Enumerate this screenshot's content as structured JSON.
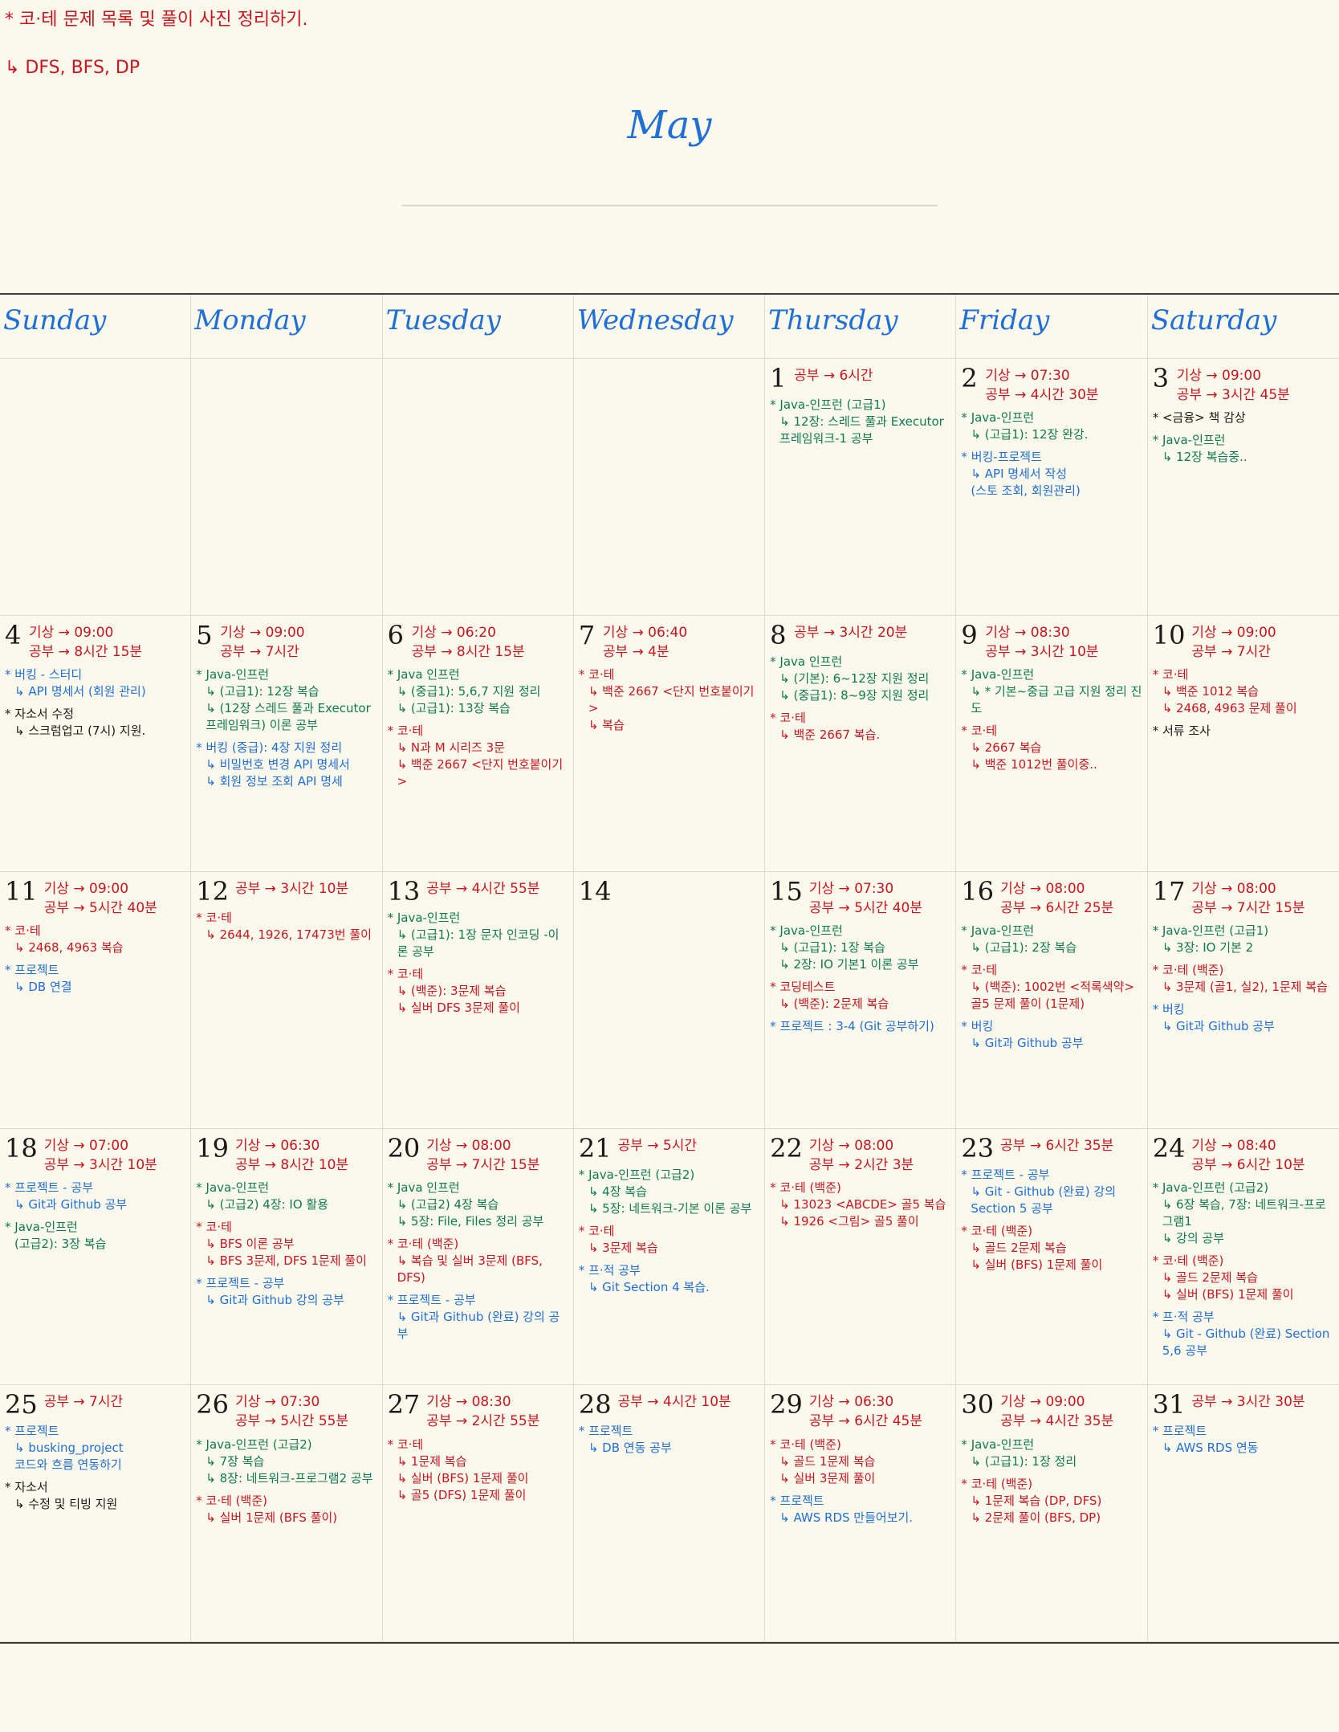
{
  "notes": [
    {
      "text": "* 코·테 문제 목록 및 풀이 사진 정리하기.",
      "color": "#cc1420"
    },
    {
      "text": "↳ DFS, BFS, DP",
      "color": "#cc1420"
    }
  ],
  "month": "May",
  "weekdays": [
    "Sunday",
    "Monday",
    "Tuesday",
    "Wednesday",
    "Thursday",
    "Friday",
    "Saturday"
  ],
  "days": [
    {
      "num": "",
      "head": [],
      "entries": []
    },
    {
      "num": "",
      "head": [],
      "entries": []
    },
    {
      "num": "",
      "head": [],
      "entries": []
    },
    {
      "num": "",
      "head": [],
      "entries": []
    },
    {
      "num": "1",
      "head": [
        "공부 → 6시간"
      ],
      "entries": [
        {
          "color": "green",
          "lines": [
            "* Java-인프런 (고급1)",
            "↳ 12장: 스레드 풀과 Executor 프레임워크-1 공부"
          ]
        }
      ]
    },
    {
      "num": "2",
      "head": [
        "기상 → 07:30",
        "공부 → 4시간 30분"
      ],
      "entries": [
        {
          "color": "green",
          "lines": [
            "* Java-인프런",
            "↳ (고급1): 12장 완강."
          ]
        },
        {
          "color": "blue",
          "lines": [
            "* 버킹-프로젝트",
            "↳ API 명세서 작성",
            "(스토 조회, 회원관리)"
          ]
        }
      ]
    },
    {
      "num": "3",
      "head": [
        "기상 → 09:00",
        "공부 → 3시간 45분"
      ],
      "entries": [
        {
          "color": "black",
          "lines": [
            "* <금융> 책 감상"
          ]
        },
        {
          "color": "green",
          "lines": [
            "* Java-인프런",
            "↳ 12장 복습중.."
          ]
        }
      ]
    },
    {
      "num": "4",
      "head": [
        "기상 → 09:00",
        "공부 → 8시간 15분"
      ],
      "entries": [
        {
          "color": "blue",
          "lines": [
            "* 버킹 - 스터디",
            "↳ API 명세서 (회원 관리)"
          ]
        },
        {
          "color": "black",
          "lines": [
            "* 자소서 수정",
            "↳ 스크럼업고 (7시) 지원."
          ]
        }
      ]
    },
    {
      "num": "5",
      "head": [
        "기상 → 09:00",
        "공부 → 7시간"
      ],
      "entries": [
        {
          "color": "green",
          "lines": [
            "* Java-인프런",
            "↳ (고급1): 12장 복습",
            "↳ (12장 스레드 풀과 Executor 프레임워크) 이론 공부"
          ]
        },
        {
          "color": "blue",
          "lines": [
            "* 버킹 (중급): 4장 지원 정리",
            "↳ 비밀번호 변경 API 명세서",
            "↳ 회원 정보 조회 API 명세"
          ]
        }
      ]
    },
    {
      "num": "6",
      "head": [
        "기상 → 06:20",
        "공부 → 8시간 15분"
      ],
      "entries": [
        {
          "color": "green",
          "lines": [
            "* Java 인프런",
            "↳ (중급1): 5,6,7 지원 정리",
            "↳ (고급1): 13장 복습"
          ]
        },
        {
          "color": "red",
          "lines": [
            "* 코·테",
            "↳ N과 M 시리즈 3문",
            "↳ 백준 2667 <단지 번호붙이기>"
          ]
        }
      ]
    },
    {
      "num": "7",
      "head": [
        "기상 → 06:40",
        "공부 → 4분"
      ],
      "entries": [
        {
          "color": "red",
          "lines": [
            "* 코·테",
            "↳ 백준 2667 <단지 번호붙이기>",
            "↳ 복습"
          ]
        }
      ]
    },
    {
      "num": "8",
      "head": [
        "공부 → 3시간 20분"
      ],
      "entries": [
        {
          "color": "green",
          "lines": [
            "* Java 인프런",
            "↳ (기본): 6~12장 지원 정리",
            "↳ (중급1): 8~9장 지원 정리"
          ]
        },
        {
          "color": "red",
          "lines": [
            "* 코·테",
            "↳ 백준 2667 복습."
          ]
        }
      ]
    },
    {
      "num": "9",
      "head": [
        "기상 → 08:30",
        "공부 → 3시간 10분"
      ],
      "entries": [
        {
          "color": "green",
          "lines": [
            "* Java-인프런",
            "↳ * 기본~중급 고급 지원 정리 진도"
          ]
        },
        {
          "color": "red",
          "lines": [
            "* 코·테",
            "↳ 2667 복습",
            "↳ 백준 1012번 풀이중.."
          ]
        }
      ]
    },
    {
      "num": "10",
      "head": [
        "기상 → 09:00",
        "공부 → 7시간"
      ],
      "entries": [
        {
          "color": "red",
          "lines": [
            "* 코·테",
            "↳ 백준 1012 복습",
            "↳ 2468, 4963 문제 풀이"
          ]
        },
        {
          "color": "black",
          "lines": [
            "* 서류 조사"
          ]
        }
      ]
    },
    {
      "num": "11",
      "head": [
        "기상 → 09:00",
        "공부 → 5시간 40분"
      ],
      "entries": [
        {
          "color": "red",
          "lines": [
            "* 코·테",
            "↳ 2468, 4963 복습"
          ]
        },
        {
          "color": "blue",
          "lines": [
            "* 프로젝트",
            "↳ DB 연결"
          ]
        }
      ]
    },
    {
      "num": "12",
      "head": [
        "공부 → 3시간 10분"
      ],
      "entries": [
        {
          "color": "red",
          "lines": [
            "* 코·테",
            "↳ 2644, 1926, 17473번 풀이"
          ]
        }
      ]
    },
    {
      "num": "13",
      "head": [
        "공부 → 4시간 55분"
      ],
      "entries": [
        {
          "color": "green",
          "lines": [
            "* Java-인프런",
            "↳ (고급1): 1장 문자 인코딩 -이론 공부"
          ]
        },
        {
          "color": "red",
          "lines": [
            "* 코·테",
            "↳ (백준): 3문제 복습",
            "↳ 실버 DFS 3문제 풀이"
          ]
        }
      ]
    },
    {
      "num": "14",
      "head": [],
      "entries": []
    },
    {
      "num": "15",
      "head": [
        "기상 → 07:30",
        "공부 → 5시간 40분"
      ],
      "entries": [
        {
          "color": "green",
          "lines": [
            "* Java-인프런",
            "↳ (고급1): 1장 복습",
            "↳ 2장: IO 기본1 이론 공부"
          ]
        },
        {
          "color": "red",
          "lines": [
            "* 코딩테스트",
            "↳ (백준): 2문제 복습"
          ]
        },
        {
          "color": "blue",
          "lines": [
            "* 프로젝트 : 3-4 (Git 공부하기)"
          ]
        }
      ]
    },
    {
      "num": "16",
      "head": [
        "기상 → 08:00",
        "공부 → 6시간 25분"
      ],
      "entries": [
        {
          "color": "green",
          "lines": [
            "* Java-인프런",
            "↳ (고급1): 2장 복습"
          ]
        },
        {
          "color": "red",
          "lines": [
            "* 코·테",
            "↳ (백준): 1002번 <적록색약>",
            "골5 문제 풀이 (1문제)"
          ]
        },
        {
          "color": "blue",
          "lines": [
            "* 버킹",
            "↳ Git과 Github 공부"
          ]
        }
      ]
    },
    {
      "num": "17",
      "head": [
        "기상 → 08:00",
        "공부 → 7시간 15분"
      ],
      "entries": [
        {
          "color": "green",
          "lines": [
            "* Java-인프런 (고급1)",
            "↳ 3장: IO 기본 2"
          ]
        },
        {
          "color": "red",
          "lines": [
            "* 코·테 (백준)",
            "↳ 3문제 (골1, 실2), 1문제 복습"
          ]
        },
        {
          "color": "blue",
          "lines": [
            "* 버킹",
            "↳ Git과 Github 공부"
          ]
        }
      ]
    },
    {
      "num": "18",
      "head": [
        "기상 → 07:00",
        "공부 → 3시간 10분"
      ],
      "entries": [
        {
          "color": "blue",
          "lines": [
            "* 프로젝트 - 공부",
            "↳ Git과 Github 공부"
          ]
        },
        {
          "color": "green",
          "lines": [
            "* Java-인프런",
            "(고급2): 3장 복습"
          ]
        }
      ]
    },
    {
      "num": "19",
      "head": [
        "기상 → 06:30",
        "공부 → 8시간 10분"
      ],
      "entries": [
        {
          "color": "green",
          "lines": [
            "* Java-인프런",
            "↳ (고급2) 4장: IO 활용"
          ]
        },
        {
          "color": "red",
          "lines": [
            "* 코·테",
            "↳ BFS 이론 공부",
            "↳ BFS 3문제, DFS 1문제 풀이"
          ]
        },
        {
          "color": "blue",
          "lines": [
            "* 프로젝트 - 공부",
            "↳ Git과 Github 강의 공부"
          ]
        }
      ]
    },
    {
      "num": "20",
      "head": [
        "기상 → 08:00",
        "공부 → 7시간 15분"
      ],
      "entries": [
        {
          "color": "green",
          "lines": [
            "* Java 인프런",
            "↳ (고급2) 4장 복습",
            "↳ 5장: File, Files 정리 공부"
          ]
        },
        {
          "color": "red",
          "lines": [
            "* 코·테 (백준)",
            "↳ 복습 및 실버 3문제 (BFS, DFS)"
          ]
        },
        {
          "color": "blue",
          "lines": [
            "* 프로젝트 - 공부",
            "↳ Git과 Github (완료) 강의 공부"
          ]
        }
      ]
    },
    {
      "num": "21",
      "head": [
        "공부 → 5시간"
      ],
      "entries": [
        {
          "color": "green",
          "lines": [
            "* Java-인프런 (고급2)",
            "↳ 4장 복습",
            "↳ 5장: 네트워크-기본 이론 공부"
          ]
        },
        {
          "color": "red",
          "lines": [
            "* 코·테",
            "↳ 3문제 복습"
          ]
        },
        {
          "color": "blue",
          "lines": [
            "* 프·적 공부",
            "↳ Git Section 4 복습."
          ]
        }
      ]
    },
    {
      "num": "22",
      "head": [
        "기상 → 08:00",
        "공부 → 2시간 3분"
      ],
      "entries": [
        {
          "color": "red",
          "lines": [
            "* 코·테 (백준)",
            "↳ 13023 <ABCDE> 골5 복습",
            "↳ 1926 <그림> 골5 풀이"
          ]
        }
      ]
    },
    {
      "num": "23",
      "head": [
        "공부 → 6시간 35분"
      ],
      "entries": [
        {
          "color": "blue",
          "lines": [
            "* 프로젝트 - 공부",
            "↳ Git - Github (완료) 강의",
            "Section 5 공부"
          ]
        },
        {
          "color": "red",
          "lines": [
            "* 코·테 (백준)",
            "↳ 골드 2문제 복습",
            "↳ 실버 (BFS) 1문제 풀이"
          ]
        }
      ]
    },
    {
      "num": "24",
      "head": [
        "기상 → 08:40",
        "공부 → 6시간 10분"
      ],
      "entries": [
        {
          "color": "green",
          "lines": [
            "* Java-인프런 (고급2)",
            "↳ 6장 복습, 7장: 네트워크-프로그램1",
            "↳ 강의 공부"
          ]
        },
        {
          "color": "red",
          "lines": [
            "* 코·테 (백준)",
            "↳ 골드 2문제 복습",
            "↳ 실버 (BFS) 1문제 풀이"
          ]
        },
        {
          "color": "blue",
          "lines": [
            "* 프·적 공부",
            "↳ Git - Github (완료) Section 5,6 공부"
          ]
        }
      ]
    },
    {
      "num": "25",
      "head": [
        "공부 → 7시간"
      ],
      "entries": [
        {
          "color": "blue",
          "lines": [
            "* 프로젝트",
            "↳ busking_project",
            "코드와 흐름 연동하기"
          ]
        },
        {
          "color": "black",
          "lines": [
            "* 자소서",
            "↳ 수정 및 티빙 지원"
          ]
        }
      ]
    },
    {
      "num": "26",
      "head": [
        "기상 → 07:30",
        "공부 → 5시간 55분"
      ],
      "entries": [
        {
          "color": "green",
          "lines": [
            "* Java-인프런 (고급2)",
            "↳ 7장 복습",
            "↳ 8장: 네트워크-프로그램2 공부"
          ]
        },
        {
          "color": "red",
          "lines": [
            "* 코·테 (백준)",
            "↳ 실버 1문제 (BFS 풀이)"
          ]
        }
      ]
    },
    {
      "num": "27",
      "head": [
        "기상 → 08:30",
        "공부 → 2시간 55분"
      ],
      "entries": [
        {
          "color": "red",
          "lines": [
            "* 코·테",
            "↳ 1문제 복습",
            "↳ 실버 (BFS) 1문제 풀이",
            "↳ 골5 (DFS) 1문제 풀이"
          ]
        }
      ]
    },
    {
      "num": "28",
      "head": [
        "공부 → 4시간 10분"
      ],
      "entries": [
        {
          "color": "blue",
          "lines": [
            "* 프로젝트",
            "↳ DB 연동 공부"
          ]
        }
      ]
    },
    {
      "num": "29",
      "head": [
        "기상 → 06:30",
        "공부 → 6시간 45분"
      ],
      "entries": [
        {
          "color": "red",
          "lines": [
            "* 코·테 (백준)",
            "↳ 골드 1문제 복습",
            "↳ 실버 3문제 풀이"
          ]
        },
        {
          "color": "blue",
          "lines": [
            "* 프로젝트",
            "↳ AWS RDS 만들어보기."
          ]
        }
      ]
    },
    {
      "num": "30",
      "head": [
        "기상 → 09:00",
        "공부 → 4시간 35분"
      ],
      "entries": [
        {
          "color": "green",
          "lines": [
            "* Java-인프런",
            "↳ (고급1): 1장 정리"
          ]
        },
        {
          "color": "red",
          "lines": [
            "* 코·테 (백준)",
            "↳ 1문제 복습 (DP, DFS)",
            "↳ 2문제 풀이 (BFS, DP)"
          ]
        }
      ]
    },
    {
      "num": "31",
      "head": [
        "공부 → 3시간 30분"
      ],
      "entries": [
        {
          "color": "blue",
          "lines": [
            "* 프로젝트",
            "↳ AWS RDS 연동"
          ]
        }
      ]
    }
  ]
}
